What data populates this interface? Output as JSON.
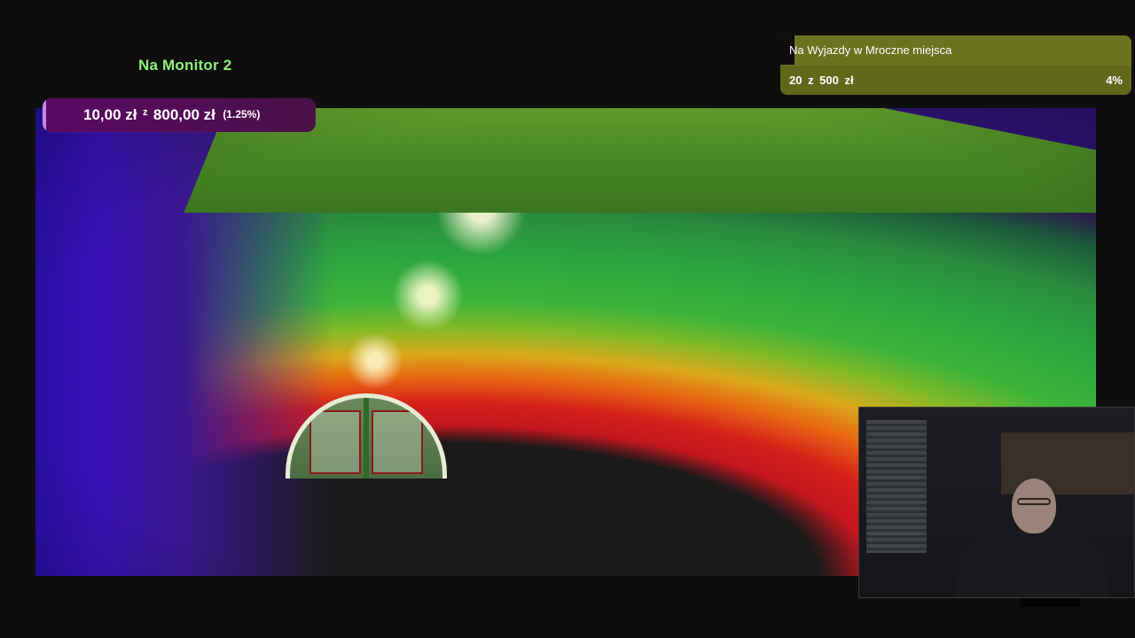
{
  "monitor_title": "Na Monitor 2",
  "donation": {
    "current": "10,00 zł",
    "separator": "z",
    "target": "800,00 zł",
    "percent_text": "(1.25%)",
    "progress_fraction": 0.0125,
    "fill_color": "#c48ae6",
    "bar_color": "#5a0a64"
  },
  "goal": {
    "name": "Na Wyjazdy w Mroczne miejsca",
    "amount_text": "20  z  500  zł",
    "percent_text": "4%",
    "progress_fraction": 0.04,
    "bar_color": "#6b731e"
  },
  "main_video": {
    "scene": "tunnel",
    "accent_colors": [
      "#c2161e",
      "#e86a12",
      "#3cb43a",
      "#2b1270"
    ]
  },
  "colors": {
    "background": "#0e0e0e",
    "monitor_title": "#8ef07a"
  }
}
